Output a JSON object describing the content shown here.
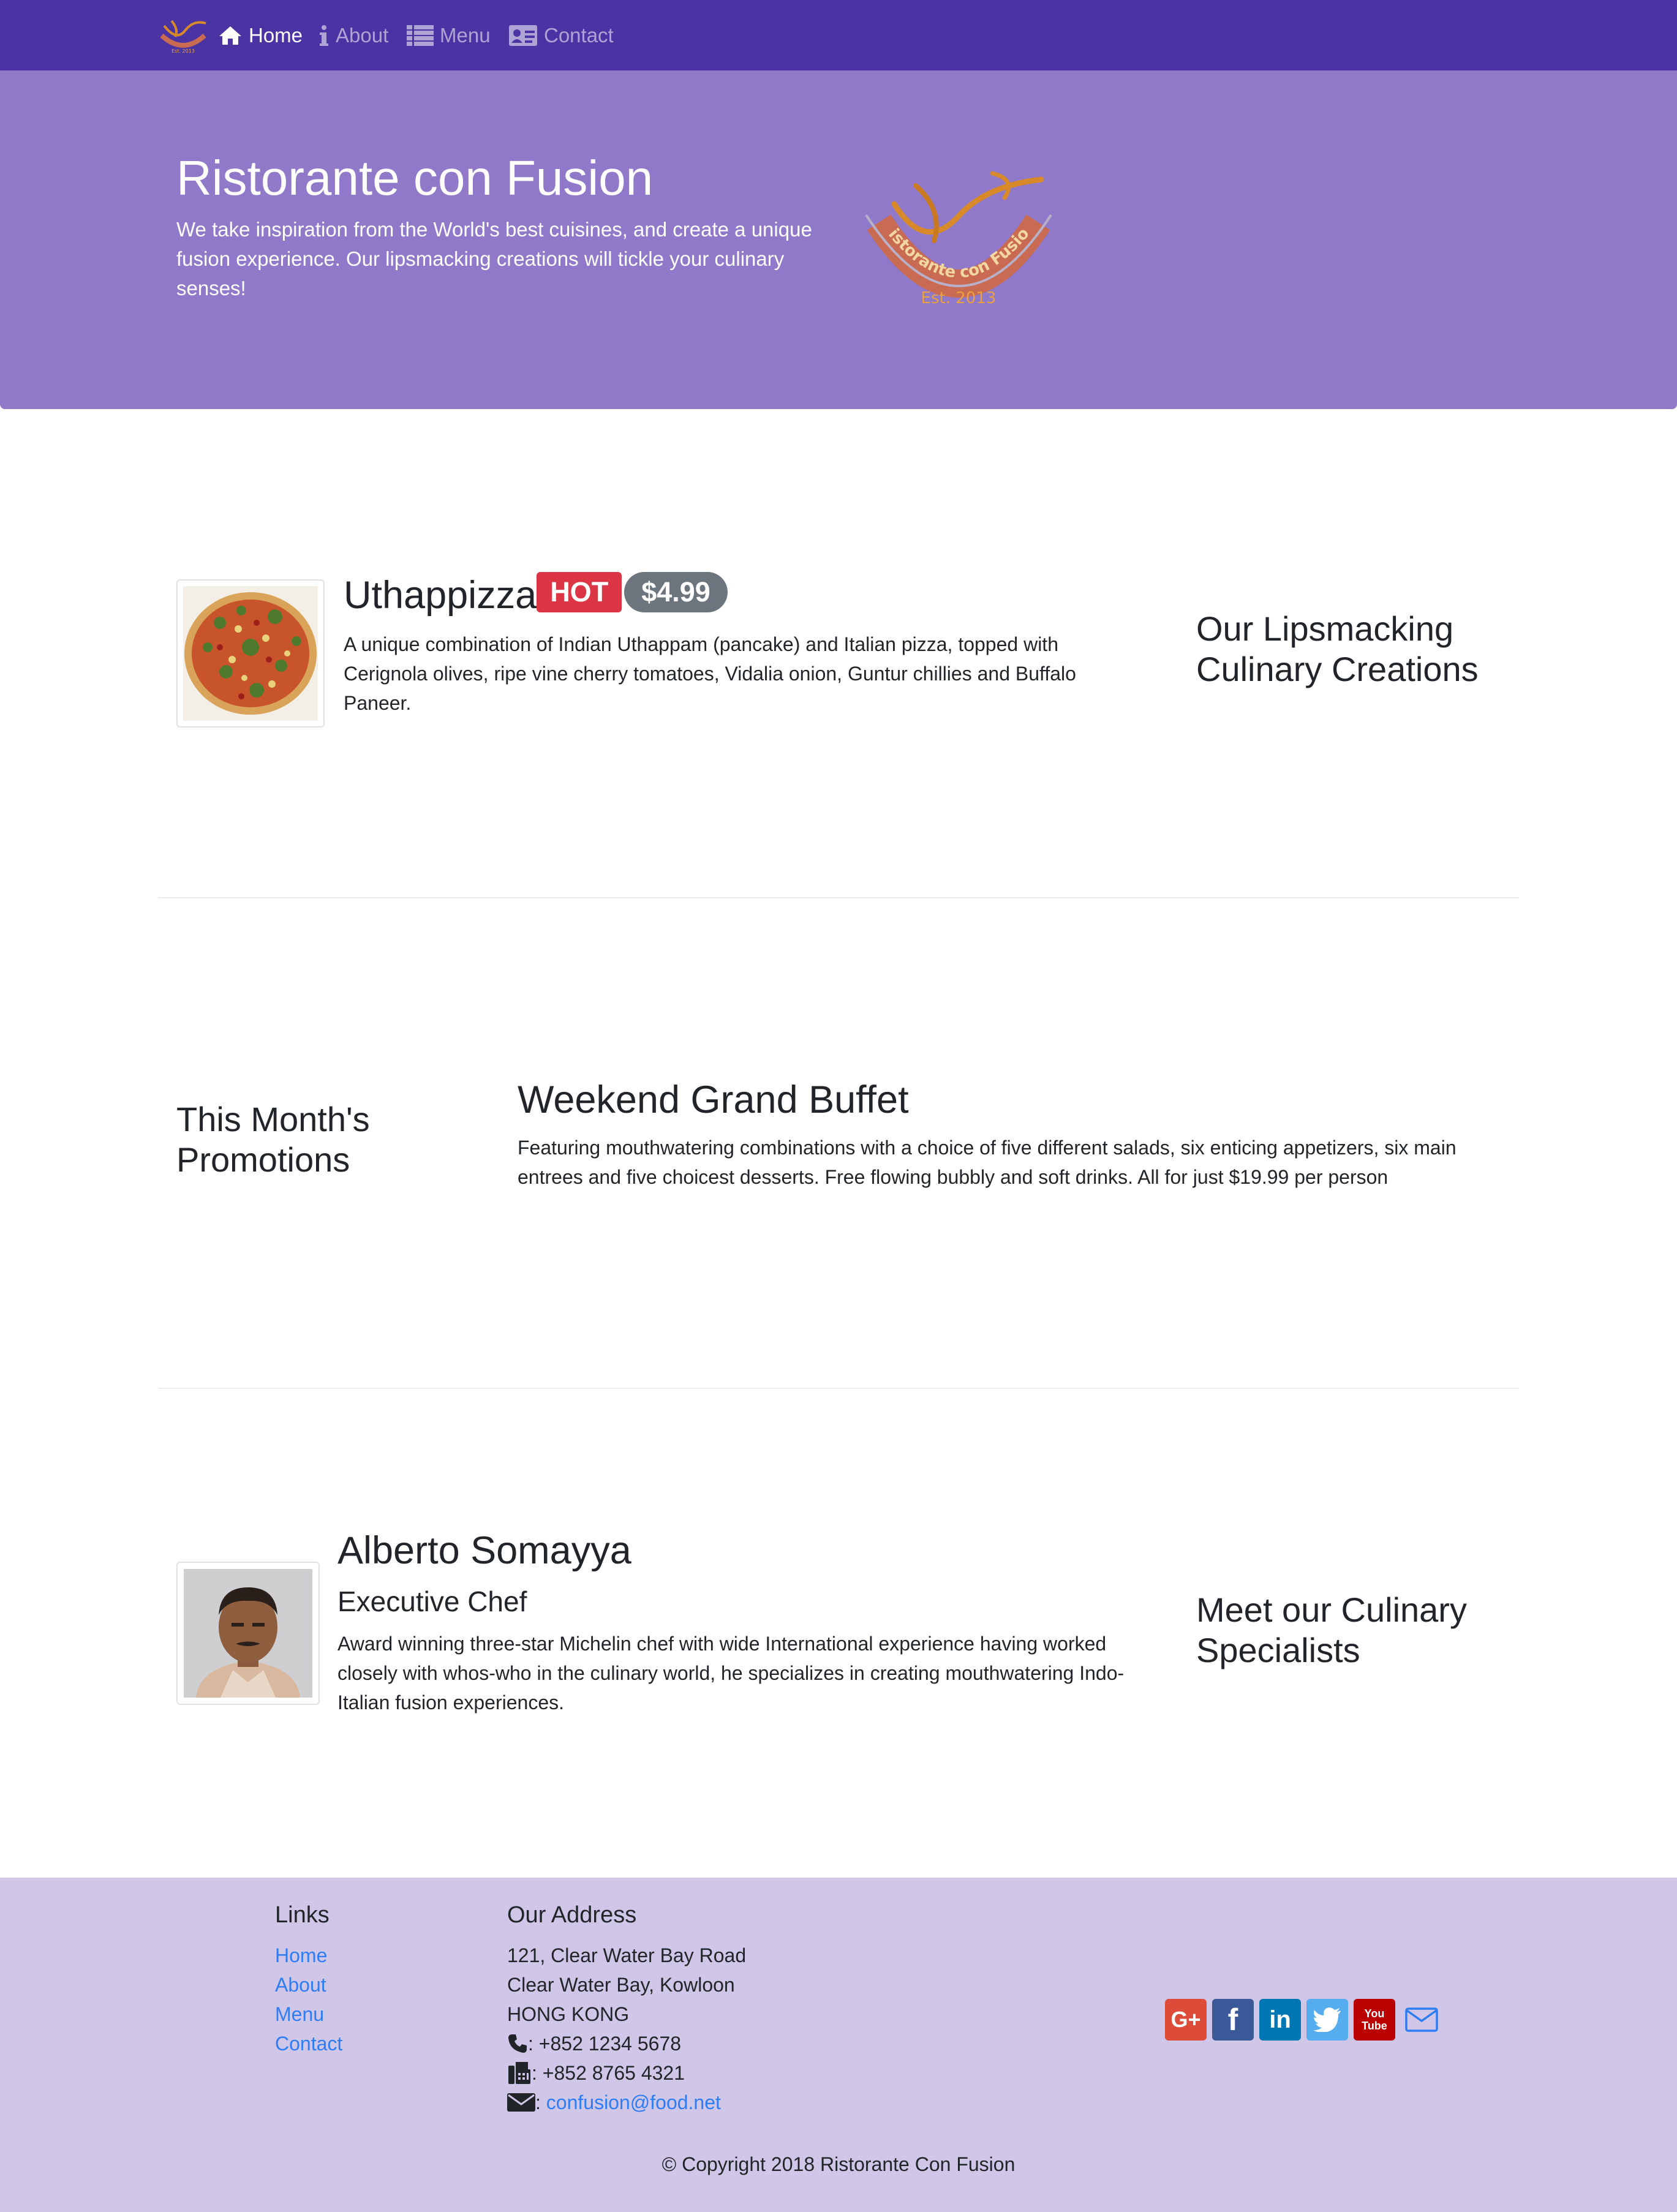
{
  "nav": {
    "items": [
      {
        "label": "Home",
        "icon": "home-icon"
      },
      {
        "label": "About",
        "icon": "info-icon"
      },
      {
        "label": "Menu",
        "icon": "list-icon"
      },
      {
        "label": "Contact",
        "icon": "address-card-icon"
      }
    ],
    "active": "Home"
  },
  "jumbotron": {
    "title": "Ristorante con Fusion",
    "text": "We take inspiration from the World's best cuisines, and create a unique fusion experience. Our lipsmacking creations will tickle your culinary senses!",
    "logo_text": "Ristorante con Fusion",
    "logo_est": "Est. 2013"
  },
  "dish": {
    "name": "Uthappizza",
    "badge": "HOT",
    "price": "$4.99",
    "description": "A unique combination of Indian Uthappam (pancake) and Italian pizza, topped with Cerignola olives, ripe vine cherry tomatoes, Vidalia onion, Guntur chillies and Buffalo Paneer.",
    "section_title": "Our Lipsmacking Culinary Creations"
  },
  "promotion": {
    "section_title": "This Month's Promotions",
    "name": "Weekend Grand Buffet",
    "description": "Featuring mouthwatering combinations with a choice of five different salads, six enticing appetizers, six main entrees and five choicest desserts. Free flowing bubbly and soft drinks. All for just $19.99 per person"
  },
  "leader": {
    "name": "Alberto Somayya",
    "designation": "Executive Chef",
    "description": "Award winning three-star Michelin chef with wide International experience having worked closely with whos-who in the culinary world, he specializes in creating mouthwatering Indo-Italian fusion experiences.",
    "section_title": "Meet our Culinary Specialists"
  },
  "footer": {
    "links_title": "Links",
    "links": [
      "Home",
      "About",
      "Menu",
      "Contact"
    ],
    "address_title": "Our Address",
    "address": [
      "121, Clear Water Bay Road",
      "Clear Water Bay, Kowloon",
      "HONG KONG"
    ],
    "phone": ": +852 1234 5678",
    "fax": ": +852 8765 4321",
    "email_prefix": ": ",
    "email": "confusion@food.net",
    "social": [
      {
        "name": "google-plus-icon",
        "color": "#dd4b39",
        "label": "G+"
      },
      {
        "name": "facebook-icon",
        "color": "#3b5998",
        "label": "f"
      },
      {
        "name": "linkedin-icon",
        "color": "#0077b5",
        "label": "in"
      },
      {
        "name": "twitter-icon",
        "color": "#55acee",
        "label": ""
      },
      {
        "name": "youtube-icon",
        "color": "#bb0000",
        "label": "You Tube"
      },
      {
        "name": "mail-icon",
        "color": "#2f7df5",
        "label": ""
      }
    ],
    "copyright": "© Copyright 2018 Ristorante Con Fusion"
  },
  "colors": {
    "navbar": "#4a33a3",
    "jumbotron": "#9079c8",
    "footer": "#d0c6e8",
    "link": "#2f7df5",
    "badge_hot": "#dc3545",
    "badge_price": "#6c757d"
  }
}
